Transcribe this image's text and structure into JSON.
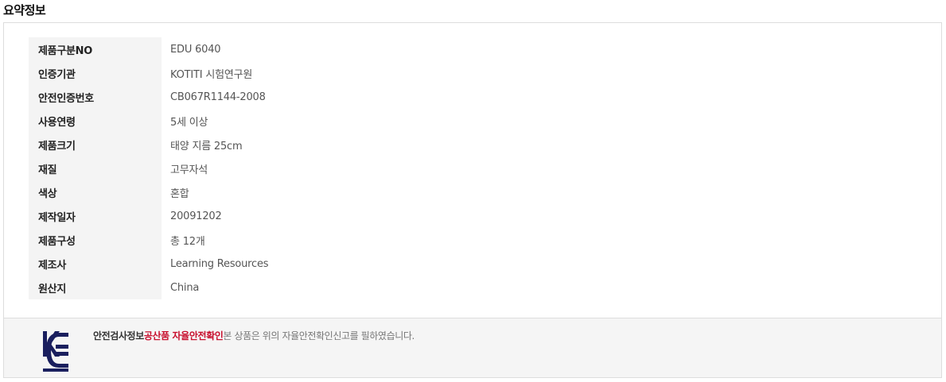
{
  "section_title": "요약정보",
  "specs": [
    {
      "label": "제품구분NO",
      "value": "EDU 6040"
    },
    {
      "label": "인증기관",
      "value": "KOTITI 시험연구원"
    },
    {
      "label": "안전인증번호",
      "value": "CB067R1144-2008"
    },
    {
      "label": "사용연령",
      "value": "5세 이상"
    },
    {
      "label": "제품크기",
      "value": "태양 지름 25cm"
    },
    {
      "label": "재질",
      "value": "고무자석"
    },
    {
      "label": "색상",
      "value": "혼합"
    },
    {
      "label": "제작일자",
      "value": "20091202"
    },
    {
      "label": "제품구성",
      "value": "총 12개"
    },
    {
      "label": "제조사",
      "value": "Learning Resources"
    },
    {
      "label": "원산지",
      "value": "China"
    }
  ],
  "safety": {
    "label": "안전검사정보",
    "type": "공산품 자율안전확인",
    "description": "본 상품은 위의 자율안전확인신고를 필하였습니다.",
    "logo_icon": "kc-certification-mark",
    "logo_color": "#1a1f5e",
    "highlight_color": "#c8102e"
  }
}
